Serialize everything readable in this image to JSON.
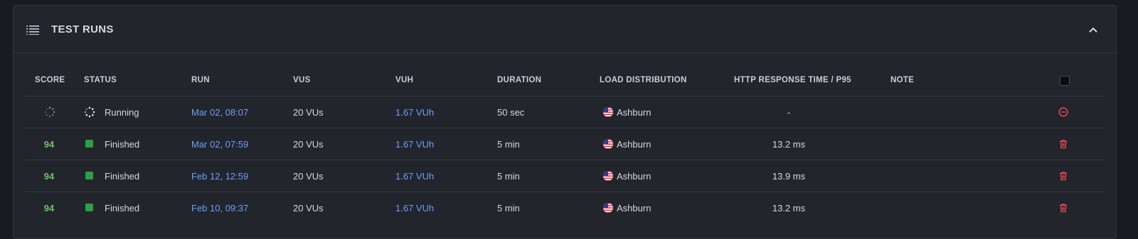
{
  "panel": {
    "title": "TEST RUNS"
  },
  "columns": {
    "score": "SCORE",
    "status": "STATUS",
    "run": "RUN",
    "vus": "VUS",
    "vuh": "VUH",
    "duration": "DURATION",
    "load_distribution": "LOAD DISTRIBUTION",
    "http_response": "HTTP RESPONSE TIME / P95",
    "note": "NOTE"
  },
  "rows": [
    {
      "score": "",
      "status": "Running",
      "run": "Mar 02, 08:07",
      "vus": "20 VUs",
      "vuh": "1.67 VUh",
      "duration": "50 sec",
      "location": "Ashburn",
      "http_p95": "-",
      "action": "stop"
    },
    {
      "score": "94",
      "status": "Finished",
      "run": "Mar 02, 07:59",
      "vus": "20 VUs",
      "vuh": "1.67 VUh",
      "duration": "5 min",
      "location": "Ashburn",
      "http_p95": "13.2 ms",
      "action": "delete"
    },
    {
      "score": "94",
      "status": "Finished",
      "run": "Feb 12, 12:59",
      "vus": "20 VUs",
      "vuh": "1.67 VUh",
      "duration": "5 min",
      "location": "Ashburn",
      "http_p95": "13.9 ms",
      "action": "delete"
    },
    {
      "score": "94",
      "status": "Finished",
      "run": "Feb 10, 09:37",
      "vus": "20 VUs",
      "vuh": "1.67 VUh",
      "duration": "5 min",
      "location": "Ashburn",
      "http_p95": "13.2 ms",
      "action": "delete"
    }
  ],
  "icons": {
    "header": "list-icon",
    "collapse": "chevron-up-icon",
    "running": "spinner-icon",
    "finished": "status-square-icon",
    "flag": "us-flag-icon",
    "stop": "stop-circle-icon",
    "delete": "trash-icon"
  },
  "colors": {
    "background": "#181b1f",
    "panel": "#22252b",
    "border": "#34373e",
    "score_green": "#73bf69",
    "finished_green": "#2ea043",
    "link_blue": "#6e9fff",
    "danger_red": "#f2495c"
  }
}
